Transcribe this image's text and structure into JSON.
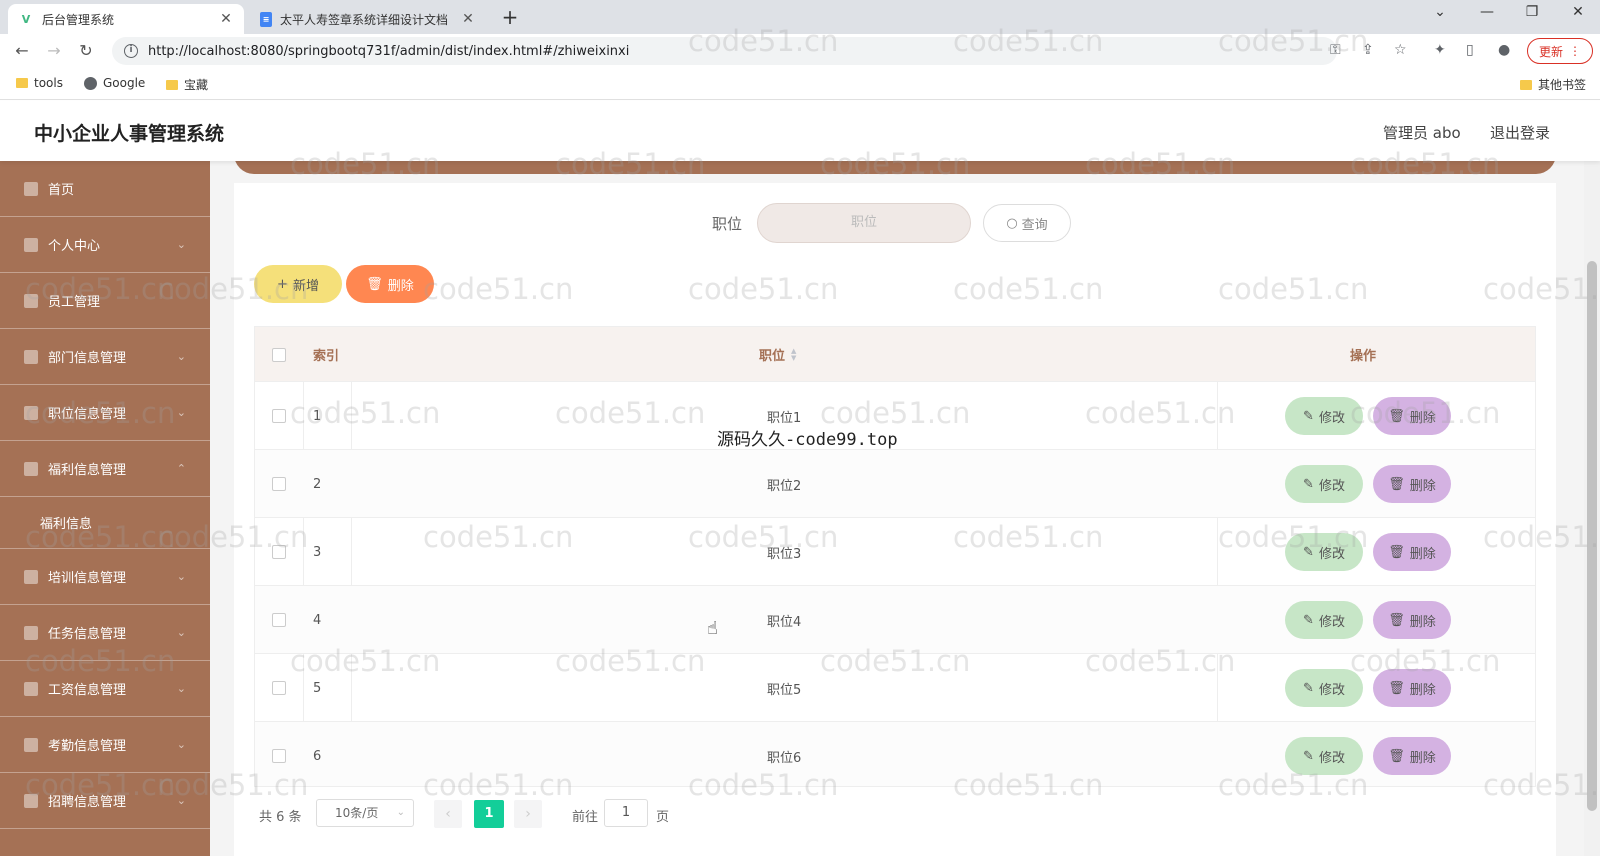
{
  "browser": {
    "tabs": [
      {
        "title": "后台管理系统",
        "active": true
      },
      {
        "title": "太平人寿签章系统详细设计文档",
        "active": false
      }
    ],
    "url": "http://localhost:8080/springbootq731f/admin/dist/index.html#/zhiweixinxi",
    "update_label": "更新",
    "bookmarks": [
      "tools",
      "Google",
      "宝藏"
    ],
    "other_bookmarks": "其他书签"
  },
  "header": {
    "title": "中小企业人事管理系统",
    "admin": "管理员 abo",
    "logout": "退出登录"
  },
  "sidebar": {
    "items": [
      {
        "label": "首页"
      },
      {
        "label": "个人中心"
      },
      {
        "label": "员工管理"
      },
      {
        "label": "部门信息管理"
      },
      {
        "label": "职位信息管理"
      },
      {
        "label": "福利信息管理"
      },
      {
        "label": "福利信息"
      },
      {
        "label": "培训信息管理"
      },
      {
        "label": "任务信息管理"
      },
      {
        "label": "工资信息管理"
      },
      {
        "label": "考勤信息管理"
      },
      {
        "label": "招聘信息管理"
      }
    ]
  },
  "search": {
    "label": "职位",
    "placeholder": "职位",
    "button": "查询"
  },
  "actions": {
    "add": "新增",
    "delete": "删除"
  },
  "table": {
    "headers": {
      "index": "索引",
      "position": "职位",
      "ops": "操作"
    },
    "rows": [
      {
        "index": "1",
        "position": "职位1"
      },
      {
        "index": "2",
        "position": "职位2"
      },
      {
        "index": "3",
        "position": "职位3"
      },
      {
        "index": "4",
        "position": "职位4"
      },
      {
        "index": "5",
        "position": "职位5"
      },
      {
        "index": "6",
        "position": "职位6"
      }
    ],
    "edit_label": "修改",
    "delete_label": "删除"
  },
  "pager": {
    "total": "共 6 条",
    "page_size": "10条/页",
    "current": "1",
    "goto_label": "前往",
    "goto_value": "1",
    "page_label": "页"
  },
  "watermarks": {
    "site": "code51.cn",
    "overlay": "源码久久-code99.top"
  },
  "colors": {
    "sidebar": "#a57155",
    "pager_active": "#13ce99",
    "add_btn": "#f5e07a",
    "delete_btn": "#ff8751",
    "edit_btn": "#c7e6c7",
    "row_delete_btn": "#d4b2e2"
  }
}
